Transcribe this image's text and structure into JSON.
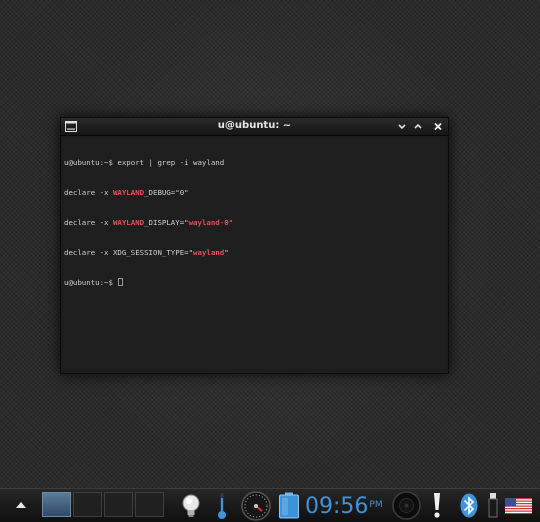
{
  "window": {
    "title": "u@ubuntu: ~",
    "icon": "terminal-icon",
    "controls": [
      "minimize-icon",
      "maximize-icon",
      "close-icon"
    ]
  },
  "terminal": {
    "line1": "u@ubuntu:~$ export | grep -i wayland",
    "line2": {
      "prefix": "declare -x ",
      "match": "WAYLAND",
      "rest": "_DEBUG=\"0\""
    },
    "line3": {
      "prefix": "declare -x ",
      "match": "WAYLAND",
      "rest1": "_DISPLAY=\"",
      "value_match": "wayland",
      "value_rest": "-0\""
    },
    "line4": {
      "prefix": "declare -x XDG_SESSION_TYPE=\"",
      "match": "wayland",
      "rest": "\""
    },
    "line5": "u@ubuntu:~$ "
  },
  "taskbar": {
    "clock_time": "09:56",
    "clock_period": "PM",
    "icons": [
      "up-arrow-icon",
      "lightbulb-icon",
      "thermometer-icon",
      "speedometer-icon",
      "battery-icon",
      "speaker-icon",
      "exclamation-icon",
      "bluetooth-icon",
      "flag-icon"
    ],
    "accent_color": "#3f93d8"
  }
}
